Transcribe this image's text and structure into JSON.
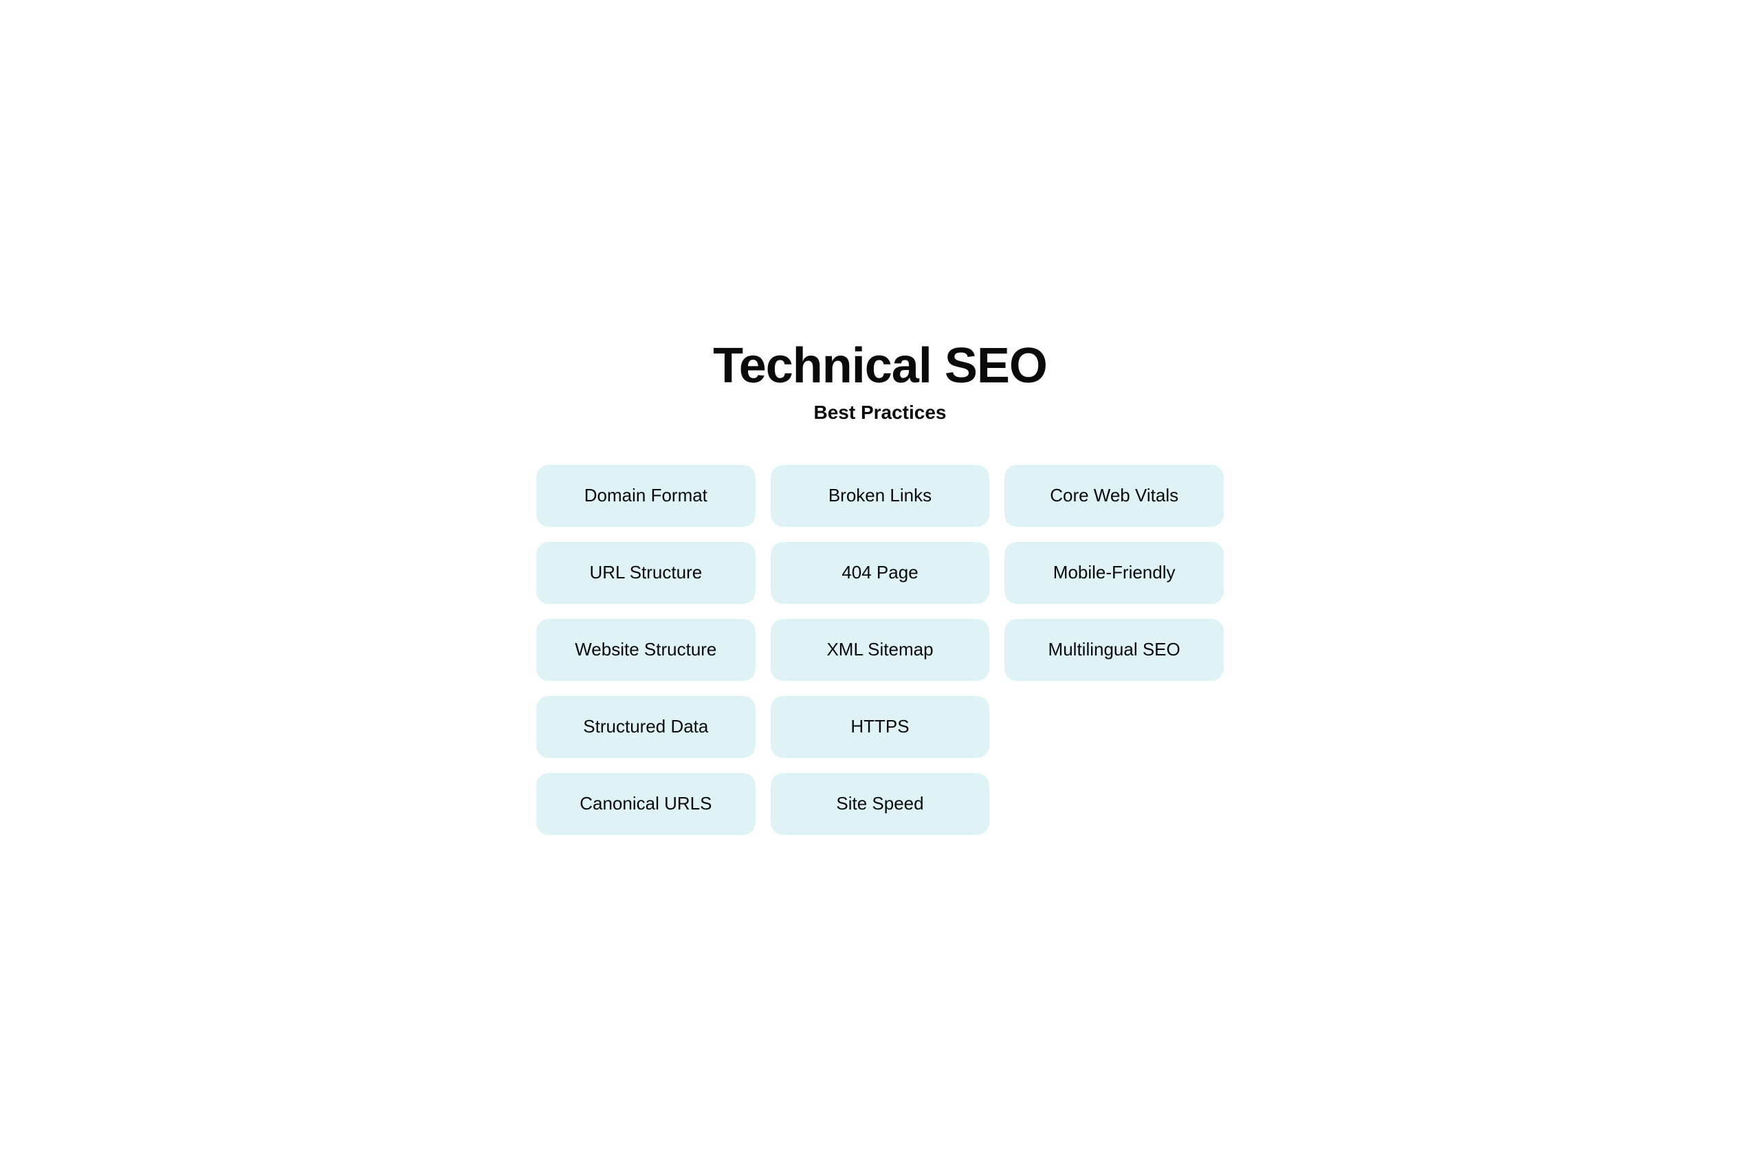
{
  "header": {
    "main_title": "Technical SEO",
    "sub_title": "Best Practices"
  },
  "grid": {
    "items": [
      {
        "id": "domain-format",
        "label": "Domain Format",
        "col": 1,
        "row": 1
      },
      {
        "id": "broken-links",
        "label": "Broken Links",
        "col": 2,
        "row": 1
      },
      {
        "id": "core-web-vitals",
        "label": "Core Web Vitals",
        "col": 3,
        "row": 1
      },
      {
        "id": "url-structure",
        "label": "URL Structure",
        "col": 1,
        "row": 2
      },
      {
        "id": "404-page",
        "label": "404 Page",
        "col": 2,
        "row": 2
      },
      {
        "id": "mobile-friendly",
        "label": "Mobile-Friendly",
        "col": 3,
        "row": 2
      },
      {
        "id": "website-structure",
        "label": "Website Structure",
        "col": 1,
        "row": 3
      },
      {
        "id": "xml-sitemap",
        "label": "XML Sitemap",
        "col": 2,
        "row": 3
      },
      {
        "id": "multilingual-seo",
        "label": "Multilingual SEO",
        "col": 3,
        "row": 3
      },
      {
        "id": "structured-data",
        "label": "Structured Data",
        "col": 1,
        "row": 4
      },
      {
        "id": "https",
        "label": "HTTPS",
        "col": 2,
        "row": 4
      },
      {
        "id": "canonical-urls",
        "label": "Canonical URLS",
        "col": 1,
        "row": 5
      },
      {
        "id": "site-speed",
        "label": "Site Speed",
        "col": 2,
        "row": 5
      }
    ]
  }
}
